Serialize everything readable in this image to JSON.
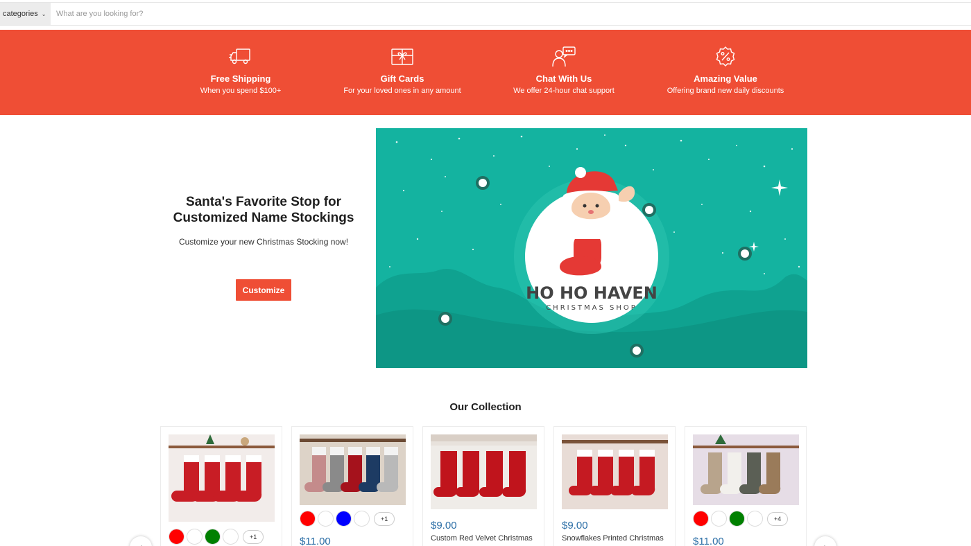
{
  "search": {
    "category_label": "categories",
    "placeholder": "What are you looking for?"
  },
  "features": [
    {
      "title": "Free Shipping",
      "subtitle": "When you spend $100+",
      "icon": "truck-icon"
    },
    {
      "title": "Gift Cards",
      "subtitle": "For your loved ones in any amount",
      "icon": "gift-card-icon"
    },
    {
      "title": "Chat With Us",
      "subtitle": "We offer 24-hour chat support",
      "icon": "chat-support-icon"
    },
    {
      "title": "Amazing Value",
      "subtitle": "Offering brand new daily discounts",
      "icon": "discount-badge-icon"
    }
  ],
  "hero": {
    "title": "Santa's Favorite Stop for Customized Name Stockings",
    "subtitle": "Customize your new Christmas Stocking now!",
    "button_label": "Customize",
    "banner_logo_title": "HO HO HAVEN",
    "banner_logo_subtitle": "CHRISTMAS SHOP"
  },
  "collection": {
    "title": "Our Collection",
    "products": [
      {
        "price": "",
        "name": "",
        "swatches": [
          "#ff0000",
          "#ffffff",
          "#008000",
          "#ffffff"
        ],
        "more": "+1"
      },
      {
        "price": "$11.00",
        "name": "",
        "swatches": [
          "#ff0000",
          "#ffffff",
          "#0000ff",
          "#ffffff"
        ],
        "more": "+1"
      },
      {
        "price": "$9.00",
        "name": "Custom Red Velvet Christmas",
        "swatches": [],
        "more": ""
      },
      {
        "price": "$9.00",
        "name": "Snowflakes Printed Christmas",
        "swatches": [],
        "more": ""
      },
      {
        "price": "$11.00",
        "name": "",
        "swatches": [
          "#ff0000",
          "#ffffff",
          "#008000",
          "#ffffff"
        ],
        "more": "+4"
      }
    ]
  },
  "colors": {
    "accent": "#ef4e35",
    "banner_teal": "#14b3a0",
    "price_blue": "#2b6ea6"
  }
}
